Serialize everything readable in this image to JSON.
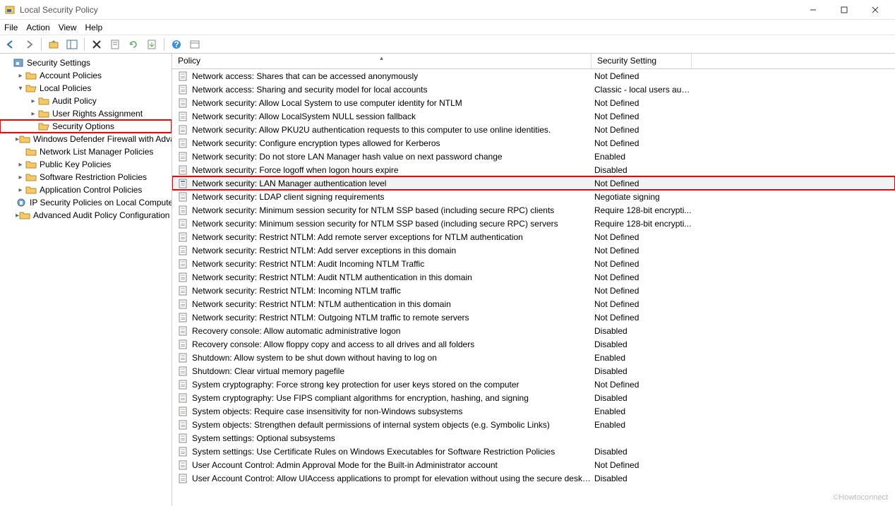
{
  "window": {
    "title": "Local Security Policy"
  },
  "menu": {
    "file": "File",
    "action": "Action",
    "view": "View",
    "help": "Help"
  },
  "columns": {
    "policy": "Policy",
    "setting": "Security Setting"
  },
  "watermark": "©Howtoconnect",
  "tree": [
    {
      "label": "Security Settings",
      "indent": 0,
      "expander": "",
      "icon": "root",
      "highlight": false
    },
    {
      "label": "Account Policies",
      "indent": 1,
      "expander": "▸",
      "icon": "folder",
      "highlight": false
    },
    {
      "label": "Local Policies",
      "indent": 1,
      "expander": "▾",
      "icon": "folder-open",
      "highlight": false
    },
    {
      "label": "Audit Policy",
      "indent": 2,
      "expander": "▸",
      "icon": "folder",
      "highlight": false
    },
    {
      "label": "User Rights Assignment",
      "indent": 2,
      "expander": "▸",
      "icon": "folder",
      "highlight": false
    },
    {
      "label": "Security Options",
      "indent": 2,
      "expander": "",
      "icon": "folder-open",
      "highlight": true
    },
    {
      "label": "Windows Defender Firewall with Advanced Security",
      "indent": 1,
      "expander": "▸",
      "icon": "folder",
      "highlight": false
    },
    {
      "label": "Network List Manager Policies",
      "indent": 1,
      "expander": "",
      "icon": "folder",
      "highlight": false
    },
    {
      "label": "Public Key Policies",
      "indent": 1,
      "expander": "▸",
      "icon": "folder",
      "highlight": false
    },
    {
      "label": "Software Restriction Policies",
      "indent": 1,
      "expander": "▸",
      "icon": "folder",
      "highlight": false
    },
    {
      "label": "Application Control Policies",
      "indent": 1,
      "expander": "▸",
      "icon": "folder",
      "highlight": false
    },
    {
      "label": "IP Security Policies on Local Computer",
      "indent": 1,
      "expander": "",
      "icon": "ipsec",
      "highlight": false
    },
    {
      "label": "Advanced Audit Policy Configuration",
      "indent": 1,
      "expander": "▸",
      "icon": "folder",
      "highlight": false
    }
  ],
  "policies": [
    {
      "name": "Network access: Shares that can be accessed anonymously",
      "setting": "Not Defined"
    },
    {
      "name": "Network access: Sharing and security model for local accounts",
      "setting": "Classic - local users auth..."
    },
    {
      "name": "Network security: Allow Local System to use computer identity for NTLM",
      "setting": "Not Defined"
    },
    {
      "name": "Network security: Allow LocalSystem NULL session fallback",
      "setting": "Not Defined"
    },
    {
      "name": "Network security: Allow PKU2U authentication requests to this computer to use online identities.",
      "setting": "Not Defined"
    },
    {
      "name": "Network security: Configure encryption types allowed for Kerberos",
      "setting": "Not Defined"
    },
    {
      "name": "Network security: Do not store LAN Manager hash value on next password change",
      "setting": "Enabled"
    },
    {
      "name": "Network security: Force logoff when logon hours expire",
      "setting": "Disabled"
    },
    {
      "name": "Network security: LAN Manager authentication level",
      "setting": "Not Defined",
      "highlight": true,
      "selected": true
    },
    {
      "name": "Network security: LDAP client signing requirements",
      "setting": "Negotiate signing"
    },
    {
      "name": "Network security: Minimum session security for NTLM SSP based (including secure RPC) clients",
      "setting": "Require 128-bit encrypti..."
    },
    {
      "name": "Network security: Minimum session security for NTLM SSP based (including secure RPC) servers",
      "setting": "Require 128-bit encrypti..."
    },
    {
      "name": "Network security: Restrict NTLM: Add remote server exceptions for NTLM authentication",
      "setting": "Not Defined"
    },
    {
      "name": "Network security: Restrict NTLM: Add server exceptions in this domain",
      "setting": "Not Defined"
    },
    {
      "name": "Network security: Restrict NTLM: Audit Incoming NTLM Traffic",
      "setting": "Not Defined"
    },
    {
      "name": "Network security: Restrict NTLM: Audit NTLM authentication in this domain",
      "setting": "Not Defined"
    },
    {
      "name": "Network security: Restrict NTLM: Incoming NTLM traffic",
      "setting": "Not Defined"
    },
    {
      "name": "Network security: Restrict NTLM: NTLM authentication in this domain",
      "setting": "Not Defined"
    },
    {
      "name": "Network security: Restrict NTLM: Outgoing NTLM traffic to remote servers",
      "setting": "Not Defined"
    },
    {
      "name": "Recovery console: Allow automatic administrative logon",
      "setting": "Disabled"
    },
    {
      "name": "Recovery console: Allow floppy copy and access to all drives and all folders",
      "setting": "Disabled"
    },
    {
      "name": "Shutdown: Allow system to be shut down without having to log on",
      "setting": "Enabled"
    },
    {
      "name": "Shutdown: Clear virtual memory pagefile",
      "setting": "Disabled"
    },
    {
      "name": "System cryptography: Force strong key protection for user keys stored on the computer",
      "setting": "Not Defined"
    },
    {
      "name": "System cryptography: Use FIPS compliant algorithms for encryption, hashing, and signing",
      "setting": "Disabled"
    },
    {
      "name": "System objects: Require case insensitivity for non-Windows subsystems",
      "setting": "Enabled"
    },
    {
      "name": "System objects: Strengthen default permissions of internal system objects (e.g. Symbolic Links)",
      "setting": "Enabled"
    },
    {
      "name": "System settings: Optional subsystems",
      "setting": ""
    },
    {
      "name": "System settings: Use Certificate Rules on Windows Executables for Software Restriction Policies",
      "setting": "Disabled"
    },
    {
      "name": "User Account Control: Admin Approval Mode for the Built-in Administrator account",
      "setting": "Not Defined"
    },
    {
      "name": "User Account Control: Allow UIAccess applications to prompt for elevation without using the secure deskt...",
      "setting": "Disabled"
    }
  ]
}
